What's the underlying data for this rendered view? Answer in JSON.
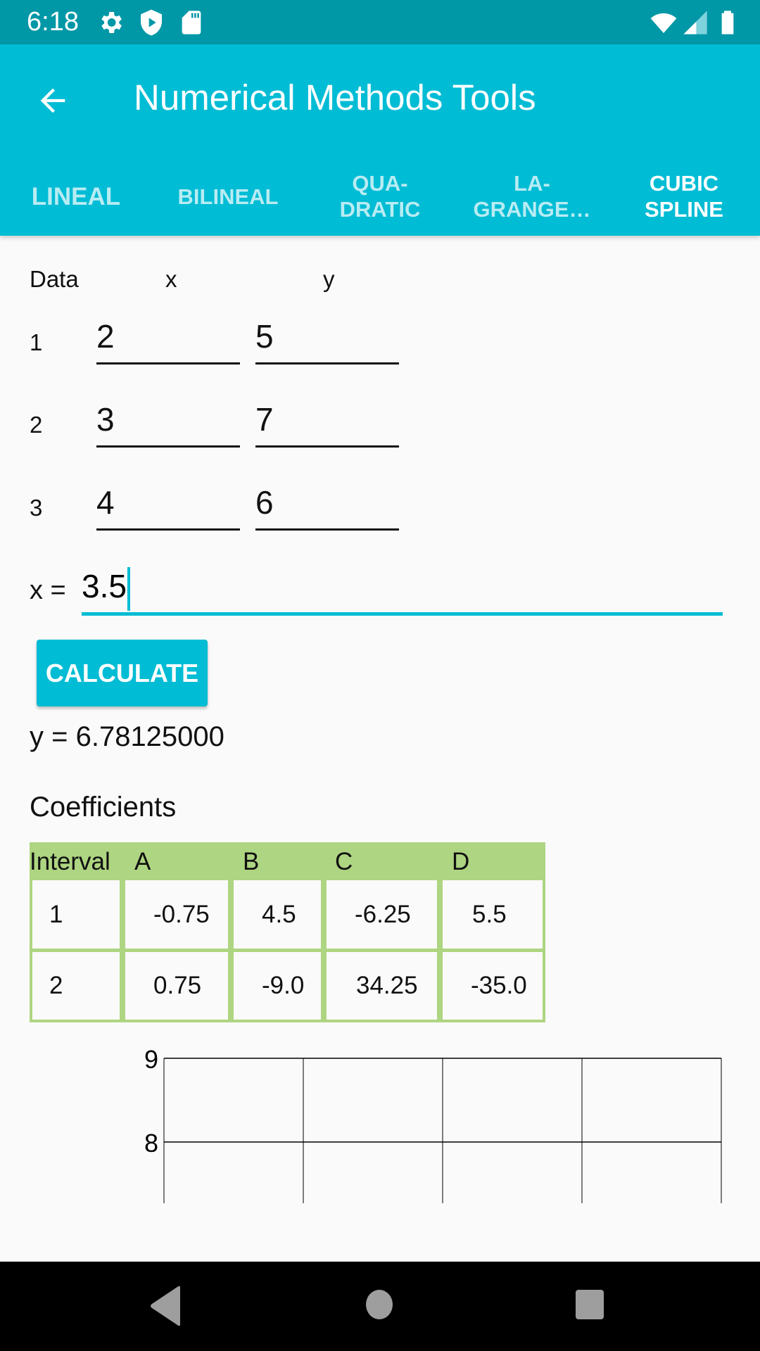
{
  "status_bar": {
    "time": "6:18",
    "left_icons": [
      "settings-icon",
      "play-protect-icon",
      "sd-card-icon"
    ],
    "right_icons": [
      "wifi-icon",
      "cell-signal-icon",
      "battery-icon"
    ]
  },
  "app_bar": {
    "title": "Numerical Methods Tools",
    "back_icon": "arrow-left-icon",
    "tabs": [
      {
        "label": "LINEAL",
        "active": false
      },
      {
        "label": "BILINEAL",
        "active": false
      },
      {
        "label": "QUA-\nDRATIC",
        "active": false
      },
      {
        "label": "LA-\nGRANGE…",
        "active": false
      },
      {
        "label": "CUBIC\nSPLINE",
        "active": true
      }
    ]
  },
  "data_section": {
    "headers": {
      "data": "Data",
      "x": "x",
      "y": "y"
    },
    "rows": [
      {
        "index": "1",
        "x": "2",
        "y": "5"
      },
      {
        "index": "2",
        "x": "3",
        "y": "7"
      },
      {
        "index": "3",
        "x": "4",
        "y": "6"
      }
    ]
  },
  "x_input": {
    "label": "x =",
    "value": "3.5"
  },
  "calculate_label": "CALCULATE",
  "result": "y = 6.78125000",
  "coefficients": {
    "title": "Coefficients",
    "columns": [
      "Interval",
      "A",
      "B",
      "C",
      "D"
    ],
    "rows": [
      [
        "1",
        "-0.75",
        "4.5",
        "-6.25",
        "5.5"
      ],
      [
        "2",
        "0.75",
        "-9.0",
        "34.25",
        "-35.0"
      ]
    ]
  },
  "colors": {
    "primary": "#00BCD4",
    "primary_dark": "#0097A7",
    "table_border": "#AED581"
  },
  "chart_data": {
    "type": "line",
    "title": "",
    "xlabel": "",
    "ylabel": "",
    "y_tick_labels": [
      "9",
      "8"
    ],
    "visible_y_range": [
      7.3,
      9
    ],
    "grid": true,
    "vertical_grid_lines": 5,
    "series": []
  },
  "nav_bar": {
    "buttons": [
      "back-icon",
      "home-icon",
      "recents-icon"
    ]
  }
}
